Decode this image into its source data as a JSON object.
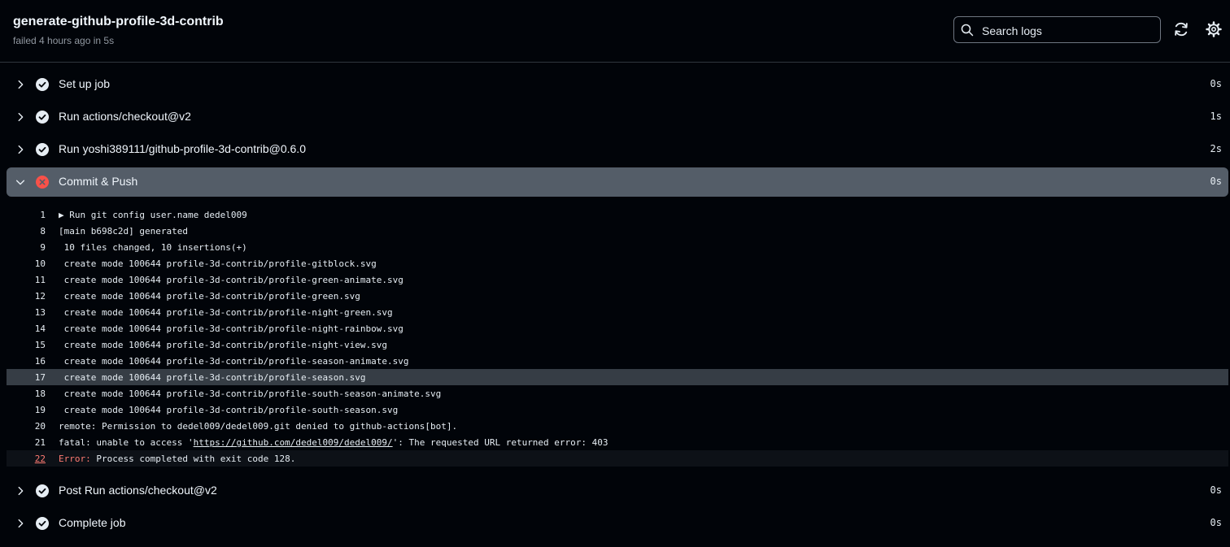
{
  "header": {
    "title": "generate-github-profile-3d-contrib",
    "subtitle": "failed 4 hours ago in 5s",
    "search_placeholder": "Search logs"
  },
  "steps_top": [
    {
      "name": "Set up job",
      "duration": "0s",
      "status": "success"
    },
    {
      "name": "Run actions/checkout@v2",
      "duration": "1s",
      "status": "success"
    },
    {
      "name": "Run yoshi389111/github-profile-3d-contrib@0.6.0",
      "duration": "2s",
      "status": "success"
    }
  ],
  "active_step": {
    "name": "Commit & Push",
    "duration": "0s",
    "status": "failure"
  },
  "log": {
    "lines": [
      {
        "num": "1",
        "text": "▶ Run git config user.name dedel009"
      },
      {
        "num": "8",
        "text": "[main b698c2d] generated"
      },
      {
        "num": "9",
        "text": " 10 files changed, 10 insertions(+)"
      },
      {
        "num": "10",
        "text": " create mode 100644 profile-3d-contrib/profile-gitblock.svg"
      },
      {
        "num": "11",
        "text": " create mode 100644 profile-3d-contrib/profile-green-animate.svg"
      },
      {
        "num": "12",
        "text": " create mode 100644 profile-3d-contrib/profile-green.svg"
      },
      {
        "num": "13",
        "text": " create mode 100644 profile-3d-contrib/profile-night-green.svg"
      },
      {
        "num": "14",
        "text": " create mode 100644 profile-3d-contrib/profile-night-rainbow.svg"
      },
      {
        "num": "15",
        "text": " create mode 100644 profile-3d-contrib/profile-night-view.svg"
      },
      {
        "num": "16",
        "text": " create mode 100644 profile-3d-contrib/profile-season-animate.svg"
      },
      {
        "num": "17",
        "text": " create mode 100644 profile-3d-contrib/profile-season.svg"
      },
      {
        "num": "18",
        "text": " create mode 100644 profile-3d-contrib/profile-south-season-animate.svg"
      },
      {
        "num": "19",
        "text": " create mode 100644 profile-3d-contrib/profile-south-season.svg"
      },
      {
        "num": "20",
        "text": "remote: Permission to dedel009/dedel009.git denied to github-actions[bot]."
      }
    ],
    "line21": {
      "num": "21",
      "prefix": "fatal: unable to access '",
      "url": "https://github.com/dedel009/dedel009/",
      "suffix": "': The requested URL returned error: 403"
    },
    "line22": {
      "num": "22",
      "label": "Error:",
      "text": " Process completed with exit code 128."
    }
  },
  "steps_bottom": [
    {
      "name": "Post Run actions/checkout@v2",
      "duration": "0s",
      "status": "success"
    },
    {
      "name": "Complete job",
      "duration": "0s",
      "status": "success"
    }
  ],
  "colors": {
    "background": "#010409",
    "active_step": "#545d68",
    "failure": "#f85149",
    "error_text": "#ff7b72"
  }
}
